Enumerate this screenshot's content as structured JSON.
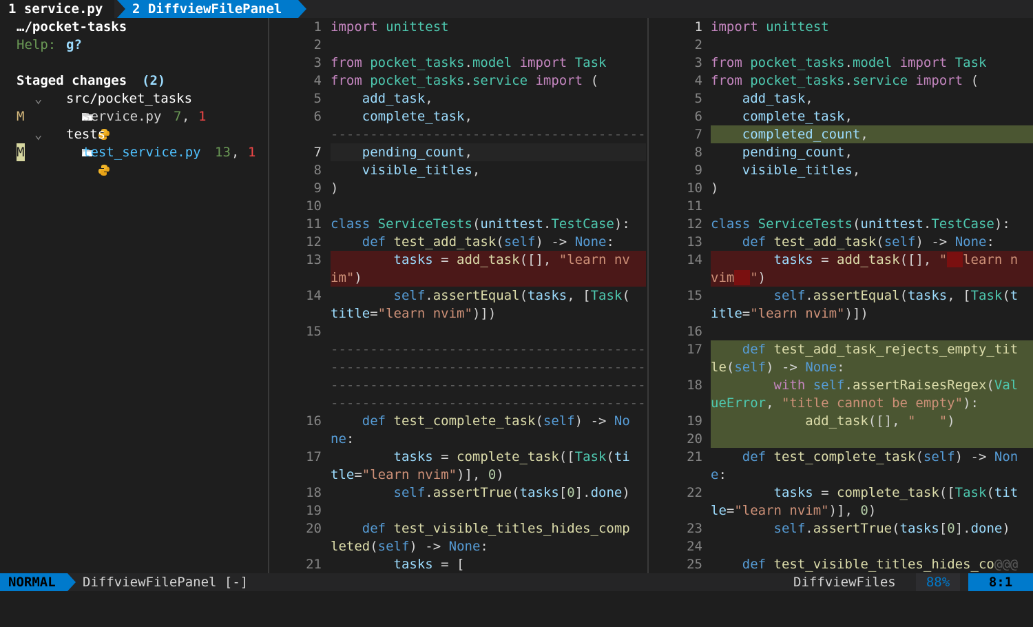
{
  "tabline": {
    "tab1": "1 service.py",
    "tab2": "2 DiffviewFilePanel"
  },
  "panel": {
    "path": "…/pocket-tasks",
    "help_label": "Help:",
    "help_key": "g?",
    "staged_title": "Staged changes",
    "staged_count": "(2)",
    "tree": [
      {
        "type": "dir",
        "name": "src/pocket_tasks"
      },
      {
        "type": "file",
        "status": "M",
        "name": "service.py",
        "adds": "7",
        "dels": "1"
      },
      {
        "type": "dir",
        "name": "tests"
      },
      {
        "type": "file",
        "status": "M",
        "name": "test_service.py",
        "adds": "13",
        "dels": "1"
      }
    ]
  },
  "statusline": {
    "mode": "NORMAL",
    "buffer": "DiffviewFilePanel [-]",
    "filetype": "DiffviewFiles",
    "percent": "88%",
    "position": "8:1"
  },
  "colors": {
    "accent": "#007acc",
    "added": "#4b5632",
    "deleted": "#4b1818",
    "changed_text": "#5c1c1c"
  }
}
